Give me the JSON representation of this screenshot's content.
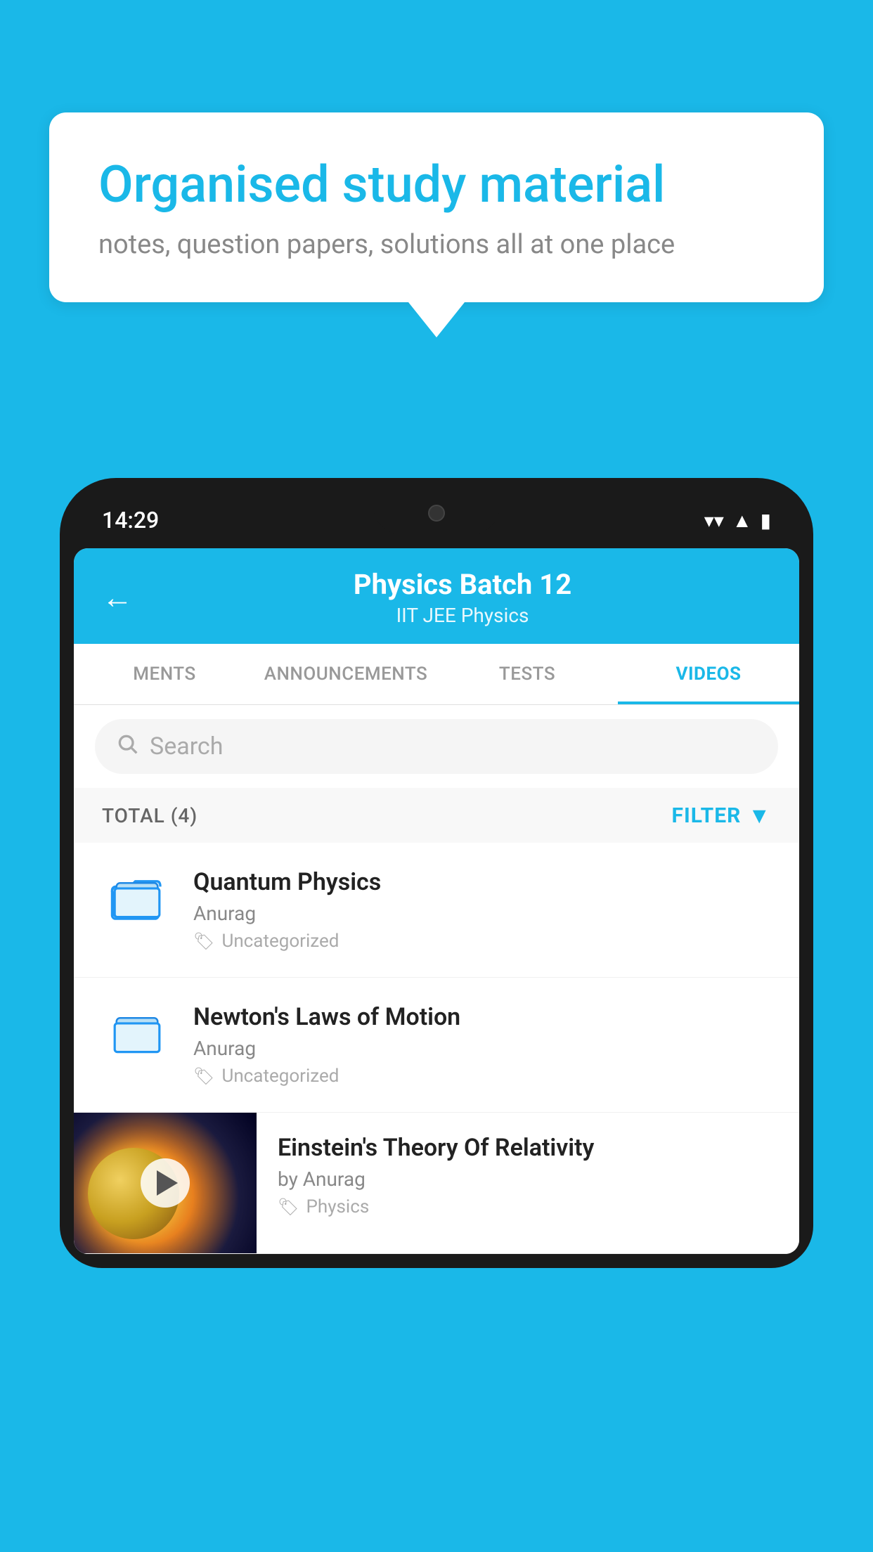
{
  "background_color": "#1ab8e8",
  "speech_bubble": {
    "title": "Organised study material",
    "subtitle": "notes, question papers, solutions all at one place"
  },
  "phone": {
    "time": "14:29",
    "header": {
      "title": "Physics Batch 12",
      "subtitle": "IIT JEE   Physics",
      "back_label": "←"
    },
    "tabs": [
      {
        "label": "MENTS",
        "active": false
      },
      {
        "label": "ANNOUNCEMENTS",
        "active": false
      },
      {
        "label": "TESTS",
        "active": false
      },
      {
        "label": "VIDEOS",
        "active": true
      }
    ],
    "search": {
      "placeholder": "Search"
    },
    "filter": {
      "total_label": "TOTAL (4)",
      "filter_label": "FILTER"
    },
    "videos": [
      {
        "id": 1,
        "title": "Quantum Physics",
        "author": "Anurag",
        "tag": "Uncategorized",
        "has_thumbnail": false
      },
      {
        "id": 2,
        "title": "Newton's Laws of Motion",
        "author": "Anurag",
        "tag": "Uncategorized",
        "has_thumbnail": false
      },
      {
        "id": 3,
        "title": "Einstein's Theory Of Relativity",
        "author": "by Anurag",
        "tag": "Physics",
        "has_thumbnail": true
      }
    ]
  }
}
